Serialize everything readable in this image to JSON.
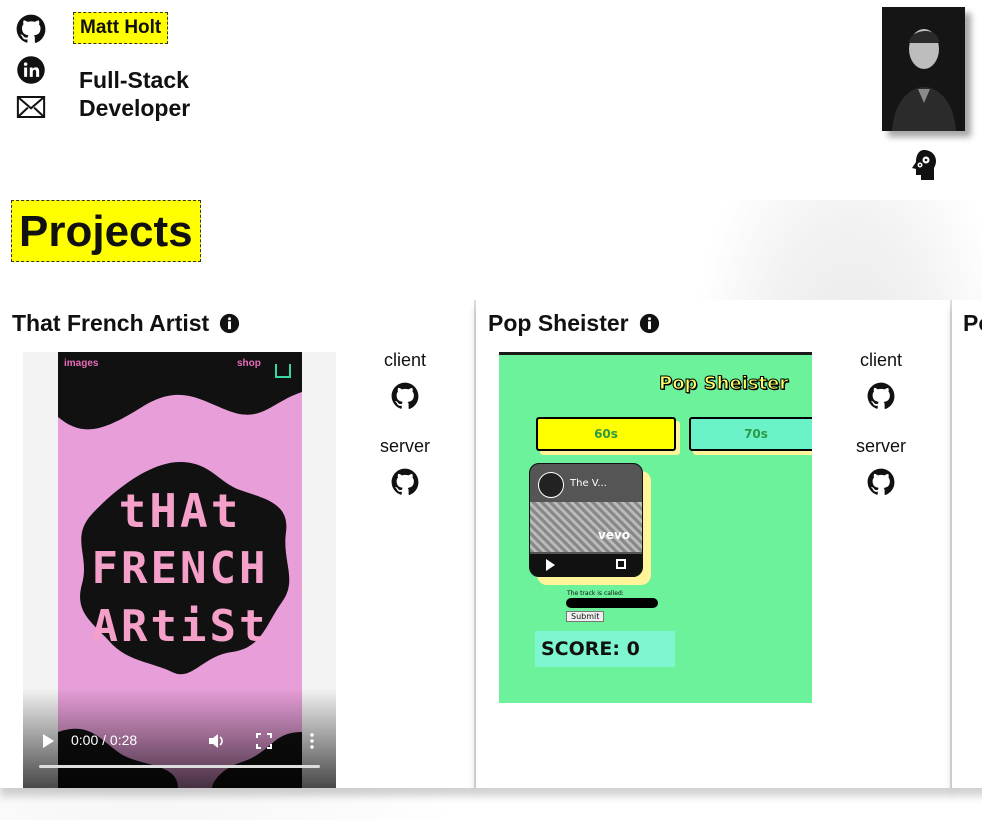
{
  "header": {
    "name": "Matt Holt",
    "role": "Full-Stack Developer"
  },
  "social": [
    "github-icon",
    "linkedin-icon",
    "mail-icon"
  ],
  "section_title": "Projects",
  "projects": [
    {
      "title": "That French Artist",
      "links": {
        "client_label": "client",
        "server_label": "server"
      },
      "video": {
        "nav_left": "images",
        "nav_right": "shop",
        "logo_line1": "tHAt",
        "logo_line2": "FRENCH",
        "logo_line3": "ARtiSt",
        "time": "0:00 / 0:28"
      }
    },
    {
      "title": "Pop Sheister",
      "links": {
        "client_label": "client",
        "server_label": "server"
      },
      "screenshot": {
        "app_title": "Pop Sheister",
        "decade_1": "60s",
        "decade_2": "70s",
        "video_title": "The V...",
        "video_brand": "vevo",
        "guess_label": "The track is called:",
        "submit": "Submit",
        "score": "SCORE: 0"
      }
    },
    {
      "title": "Po"
    }
  ],
  "colors": {
    "highlight": "#ffff00",
    "pink": "#e89fd9",
    "mint": "#6cf29b"
  }
}
